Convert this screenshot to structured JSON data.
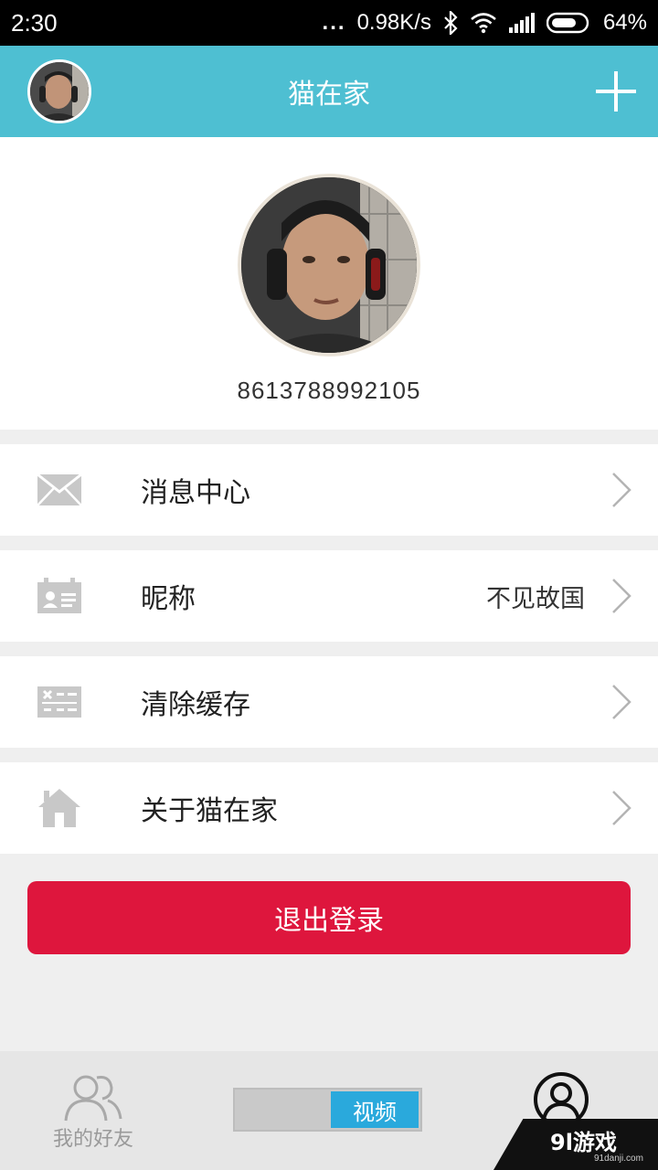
{
  "status_bar": {
    "time": "2:30",
    "dots": "...",
    "speed": "0.98K/s",
    "battery": "64%"
  },
  "header": {
    "title": "猫在家"
  },
  "profile": {
    "phone": "8613788992105"
  },
  "menu": {
    "items": [
      {
        "label": "消息中心",
        "value": "",
        "icon": "mail-icon"
      },
      {
        "label": "昵称",
        "value": "不见故国",
        "icon": "id-card-icon"
      },
      {
        "label": "清除缓存",
        "value": "",
        "icon": "clear-cache-icon"
      },
      {
        "label": "关于猫在家",
        "value": "",
        "icon": "home-icon"
      }
    ]
  },
  "logout": {
    "label": "退出登录"
  },
  "bottom_nav": {
    "friends_label": "我的好友",
    "video_label": "视频"
  },
  "watermark": {
    "main": "9l游戏",
    "sub": "91danji.com"
  },
  "colors": {
    "header_bg": "#4ebfd2",
    "logout_bg": "#de163d",
    "toggle_active": "#2aa9dc"
  }
}
